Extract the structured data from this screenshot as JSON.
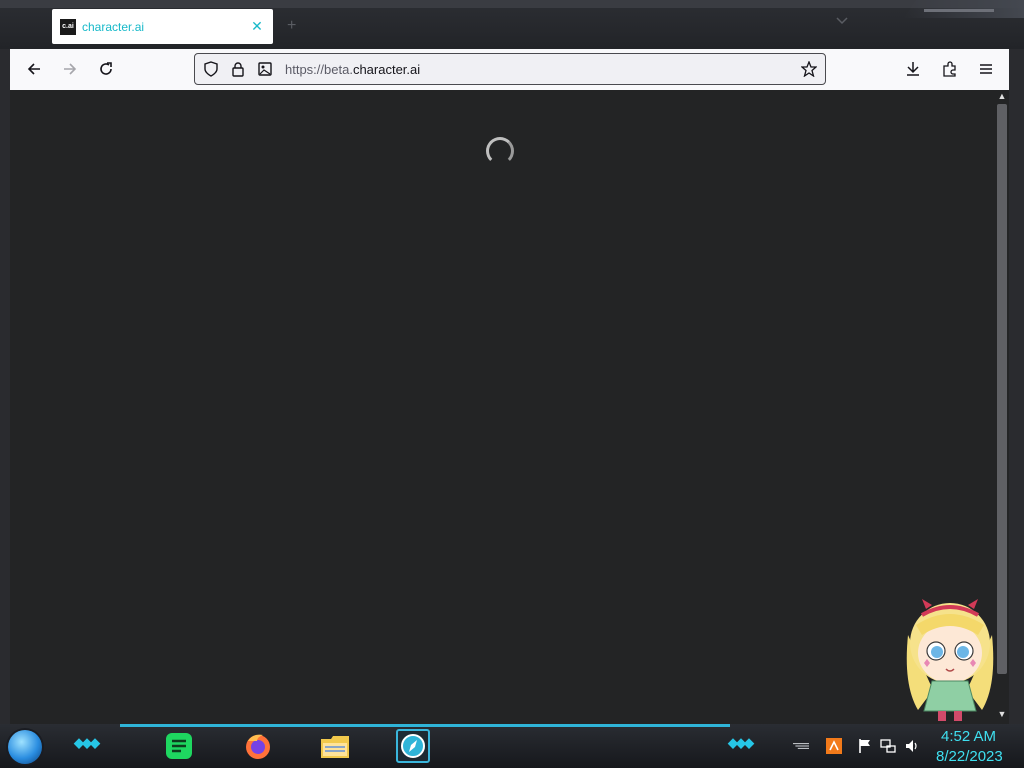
{
  "browser": {
    "tab": {
      "favicon_text": "c.ai",
      "title": "character.ai",
      "close_glyph": "✕"
    },
    "new_tab_glyph": "+",
    "url": {
      "prefix": "https://beta.",
      "domain": "character.ai"
    },
    "icons": {
      "back": "arrow-left-icon",
      "forward": "arrow-right-icon",
      "reload": "reload-icon",
      "shield": "shield-icon",
      "lock": "lock-icon",
      "permissions": "image-permission-icon",
      "bookmark": "star-icon",
      "downloads": "download-icon",
      "extensions": "puzzle-icon",
      "menu": "hamburger-menu-icon"
    }
  },
  "page": {
    "state": "loading",
    "background": "#232425"
  },
  "taskbar": {
    "apps": [
      {
        "name": "spotify-like-notes",
        "color": "#1ed760"
      },
      {
        "name": "firefox",
        "color": "#ff7139"
      },
      {
        "name": "file-explorer",
        "color": "#f2c94c"
      },
      {
        "name": "browser-active",
        "color": "#2fb4d8",
        "active": true
      }
    ],
    "clock": {
      "time": "4:52 AM",
      "date": "8/22/2023"
    },
    "accent": "#26c6e6"
  }
}
